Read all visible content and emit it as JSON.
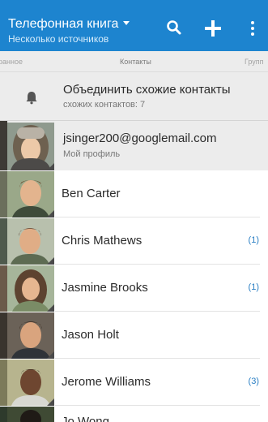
{
  "header": {
    "title": "Телефонная книга",
    "subtitle": "Несколько источников",
    "icons": [
      "search-icon",
      "add-icon",
      "more-vert-icon"
    ],
    "bg_color": "#1d84cf"
  },
  "tabs": {
    "left": "ранное",
    "center": "Контакты",
    "right": "Групп"
  },
  "merge": {
    "title": "Объединить схожие контакты",
    "subtitle": "схожих контактов: 7",
    "icon": "bell-icon"
  },
  "profile": {
    "email": "jsinger200@googlemail.com",
    "label": "Мой профиль"
  },
  "contacts": [
    {
      "name": "Ben Carter",
      "count": ""
    },
    {
      "name": "Chris Mathews",
      "count": "(1)"
    },
    {
      "name": "Jasmine Brooks",
      "count": "(1)"
    },
    {
      "name": "Jason Holt",
      "count": ""
    },
    {
      "name": "Jerome Williams",
      "count": "(3)"
    },
    {
      "name": "Jo Wong",
      "count": ""
    }
  ],
  "colors": {
    "accent": "#1d84cf",
    "count": "#2a7fc4"
  }
}
